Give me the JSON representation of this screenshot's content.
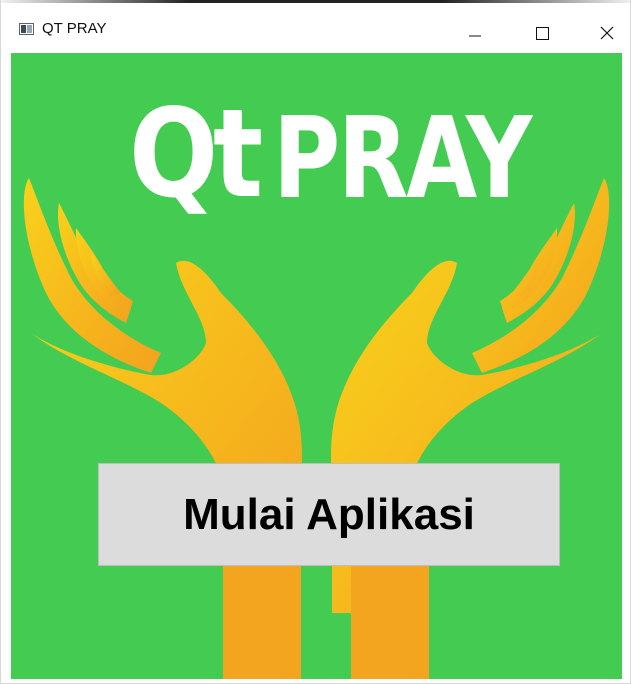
{
  "window": {
    "title": "QT PRAY",
    "icon": "app-window-icon",
    "controls": [
      "minimize-icon",
      "maximize-icon",
      "close-icon"
    ]
  },
  "logo": {
    "qt": "Qt",
    "pray": "PRAY"
  },
  "main": {
    "start_button_label": "Mulai Aplikasi"
  },
  "colors": {
    "background": "#43cb52",
    "logo_text": "#ffffff",
    "hands": "#f7b21f",
    "button": "#dcdcdc"
  }
}
